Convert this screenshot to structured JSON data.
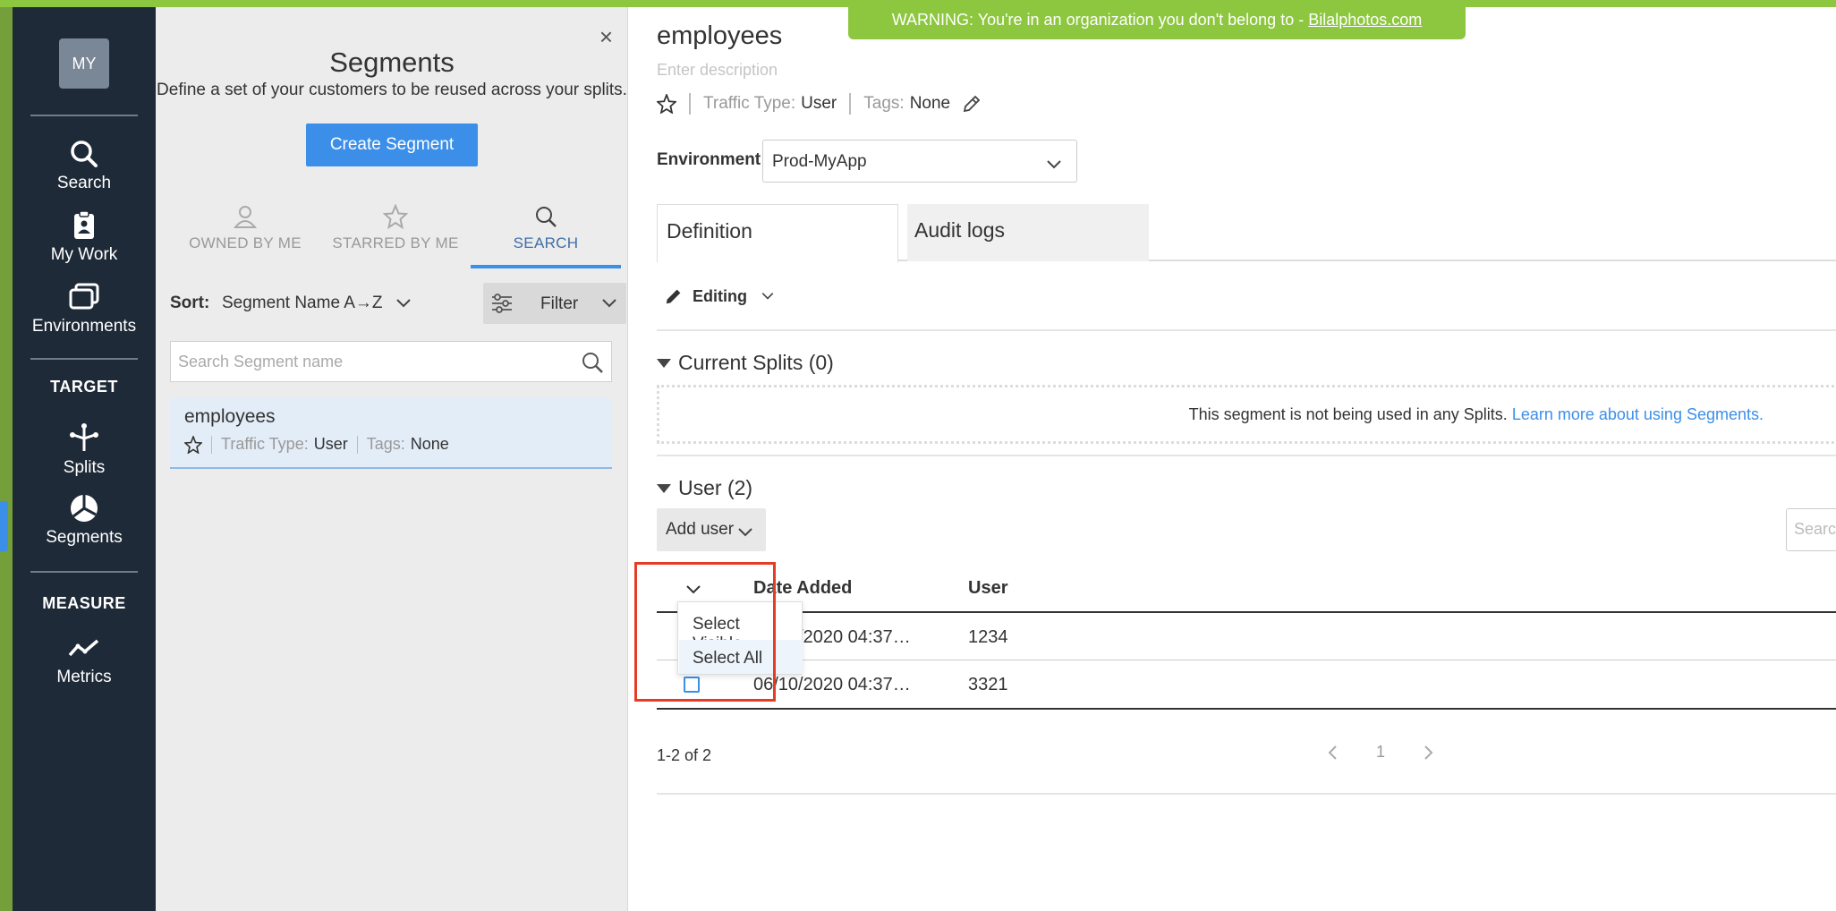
{
  "nav": {
    "avatar": "MY",
    "items": [
      {
        "label": "Search",
        "icon": "search-icon"
      },
      {
        "label": "My Work",
        "icon": "clipboard-icon"
      },
      {
        "label": "Environments",
        "icon": "windows-icon"
      },
      {
        "label": "Splits",
        "icon": "split-icon"
      },
      {
        "label": "Segments",
        "icon": "pie-icon"
      },
      {
        "label": "Metrics",
        "icon": "trend-icon"
      }
    ],
    "sections": {
      "target": "TARGET",
      "measure": "MEASURE"
    },
    "active_color": "#3c8fe8"
  },
  "segments_panel": {
    "title": "Segments",
    "subtitle": "Define a set of your customers to be reused across your splits.",
    "create_button": "Create Segment",
    "tabs": [
      {
        "label": "OWNED BY ME",
        "icon": "person-icon"
      },
      {
        "label": "STARRED BY ME",
        "icon": "star-icon"
      },
      {
        "label": "SEARCH",
        "icon": "search-icon",
        "active": true
      }
    ],
    "sort_label": "Sort:",
    "sort_value": "Segment Name A→Z",
    "filter_label": "Filter",
    "search_placeholder": "Search Segment name",
    "items": [
      {
        "name": "employees",
        "traffic_type_label": "Traffic Type:",
        "traffic_type": "User",
        "tags_label": "Tags:",
        "tags": "None"
      }
    ]
  },
  "main": {
    "warning_prefix": "WARNING: You're in an organization you don't belong to - ",
    "warning_link": "Bilalphotos.com",
    "title": "employees",
    "description_placeholder": "Enter description",
    "traffic_type_label": "Traffic Type:",
    "traffic_type": "User",
    "tags_label": "Tags:",
    "tags": "None",
    "environment_label": "Environment",
    "environment_value": "Prod-MyApp",
    "tabs": [
      "Definition",
      "Audit logs"
    ],
    "editing_label": "Editing",
    "current_splits_header": "Current Splits (0)",
    "splits_empty_msg": "This segment is not being used in any Splits.",
    "splits_learn_link": "Learn more about using Segments.",
    "user_header": "User (2)",
    "add_user_button": "Add user",
    "right_search_placeholder": "Search",
    "table": {
      "columns": [
        "Date Added",
        "User"
      ],
      "rows": [
        {
          "date": "06/10/2020 04:37…",
          "user": "1234"
        },
        {
          "date": "06/10/2020 04:37…",
          "user": "3321"
        }
      ]
    },
    "select_dropdown": [
      "Select Visible",
      "Select All"
    ],
    "pager_info": "1-2 of 2",
    "page": "1",
    "highlight_color": "#e53c25"
  }
}
